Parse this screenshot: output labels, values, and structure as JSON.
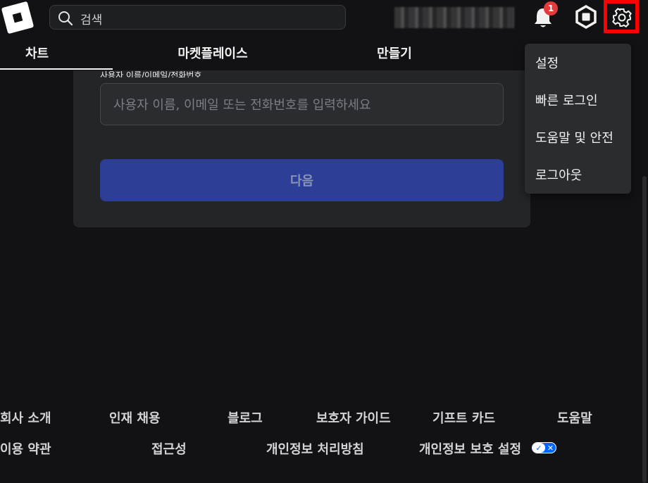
{
  "header": {
    "search_placeholder": "검색",
    "notification_count": "1"
  },
  "tabs": [
    {
      "label": "차트",
      "active": true
    },
    {
      "label": "마켓플레이스",
      "active": false
    },
    {
      "label": "만들기",
      "active": false
    }
  ],
  "login": {
    "field_label": "사용자 이름/이메일/전화번호",
    "field_placeholder": "사용자 이름, 이메일 또는 전화번호를 입력하세요",
    "next_button": "다음"
  },
  "menu": {
    "items": [
      "설정",
      "빠른 로그인",
      "도움말 및 안전",
      "로그아웃"
    ]
  },
  "footer": {
    "row1": [
      "회사 소개",
      "인재 채용",
      "블로그",
      "보호자 가이드",
      "기프트 카드",
      "도움말"
    ],
    "row2": [
      "이용 약관",
      "접근성",
      "개인정보 처리방침",
      "개인정보 보호 설정"
    ]
  },
  "colors": {
    "background": "#121215",
    "accent_button": "#2c3e95",
    "badge": "#e33b3b",
    "highlight_box": "#ff0000"
  }
}
